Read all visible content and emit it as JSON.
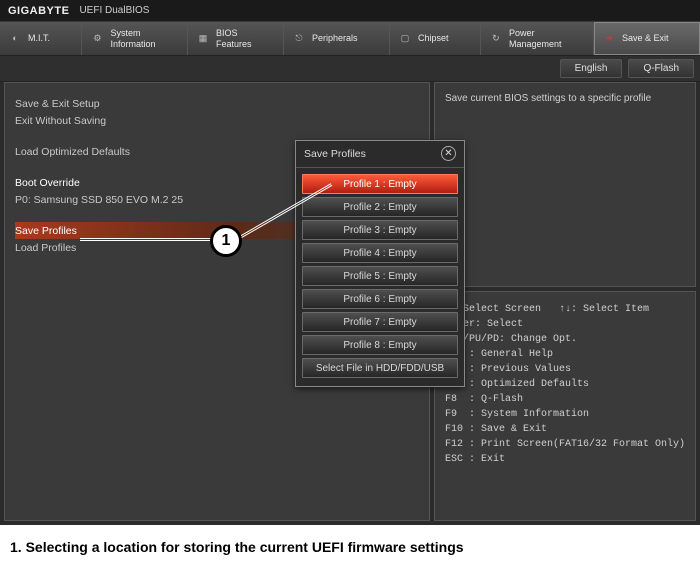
{
  "brand": "GIGABYTE",
  "brand_sub": "UEFI DualBIOS",
  "tabs": [
    {
      "label": "M.I.T.",
      "icon": "◐"
    },
    {
      "label": "System\nInformation",
      "icon": "⚙"
    },
    {
      "label": "BIOS\nFeatures",
      "icon": "▦"
    },
    {
      "label": "Peripherals",
      "icon": "⎋"
    },
    {
      "label": "Chipset",
      "icon": "▢"
    },
    {
      "label": "Power\nManagement",
      "icon": "↻"
    },
    {
      "label": "Save & Exit",
      "icon": "➜"
    }
  ],
  "secondbar": {
    "lang": "English",
    "qflash": "Q-Flash"
  },
  "left_items": {
    "save_exit": "Save & Exit Setup",
    "exit_no_save": "Exit Without Saving",
    "load_defaults": "Load Optimized Defaults",
    "boot_override": "Boot Override",
    "boot_dev0": "P0: Samsung SSD 850 EVO M.2 25",
    "save_profiles": "Save Profiles",
    "load_profiles": "Load Profiles"
  },
  "description": "Save current BIOS settings to a specific profile",
  "help_text": "↔: Select Screen   ↑↓: Select Item\nEnter: Select\n+/-/PU/PD: Change Opt.\nF1  : General Help\nF5  : Previous Values\nF7  : Optimized Defaults\nF8  : Q-Flash\nF9  : System Information\nF10 : Save & Exit\nF12 : Print Screen(FAT16/32 Format Only)\nESC : Exit",
  "modal": {
    "title": "Save Profiles",
    "options": [
      "Profile 1 : Empty",
      "Profile 2 : Empty",
      "Profile 3 : Empty",
      "Profile 4 : Empty",
      "Profile 5 : Empty",
      "Profile 6 : Empty",
      "Profile 7 : Empty",
      "Profile 8 : Empty",
      "Select File in HDD/FDD/USB"
    ]
  },
  "callout": {
    "num": "1"
  },
  "caption": "1. Selecting a location for storing the current UEFI firmware settings"
}
